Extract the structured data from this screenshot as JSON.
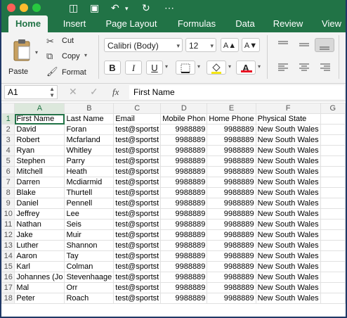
{
  "ribbon": {
    "tabs": [
      "Home",
      "Insert",
      "Page Layout",
      "Formulas",
      "Data",
      "Review",
      "View"
    ],
    "paste_label": "Paste",
    "cut_label": "Cut",
    "copy_label": "Copy",
    "format_label": "Format",
    "font_name": "Calibri (Body)",
    "font_size": "12",
    "bold": "B",
    "italic": "I",
    "underline": "U",
    "grow_font": "A▲",
    "shrink_font": "A▼",
    "highlight_color": "#f5e614",
    "font_color": "#e81123"
  },
  "formula_bar": {
    "name_box": "A1",
    "fx": "fx",
    "content": "First Name"
  },
  "sheet": {
    "columns": [
      "A",
      "B",
      "C",
      "D",
      "E",
      "F",
      "G"
    ],
    "rows": [
      [
        "First Name",
        "Last Name",
        "Email",
        "Mobile Phon",
        "Home Phone",
        "Physical State",
        ""
      ],
      [
        "David",
        "Foran",
        "test@sportst",
        "9988889",
        "9988889",
        "New South Wales",
        ""
      ],
      [
        "Robert",
        "Mcfarland",
        "test@sportst",
        "9988889",
        "9988889",
        "New South Wales",
        ""
      ],
      [
        "Ryan",
        "Whitley",
        "test@sportst",
        "9988889",
        "9988889",
        "New South Wales",
        ""
      ],
      [
        "Stephen",
        "Parry",
        "test@sportst",
        "9988889",
        "9988889",
        "New South Wales",
        ""
      ],
      [
        "Mitchell",
        "Heath",
        "test@sportst",
        "9988889",
        "9988889",
        "New South Wales",
        ""
      ],
      [
        "Darren",
        "Mcdiarmid",
        "test@sportst",
        "9988889",
        "9988889",
        "New South Wales",
        ""
      ],
      [
        "Blake",
        "Thurtell",
        "test@sportst",
        "9988889",
        "9988889",
        "New South Wales",
        ""
      ],
      [
        "Daniel",
        "Pennell",
        "test@sportst",
        "9988889",
        "9988889",
        "New South Wales",
        ""
      ],
      [
        "Jeffrey",
        "Lee",
        "test@sportst",
        "9988889",
        "9988889",
        "New South Wales",
        ""
      ],
      [
        "Nathan",
        "Seis",
        "test@sportst",
        "9988889",
        "9988889",
        "New South Wales",
        ""
      ],
      [
        "Jake",
        "Muir",
        "test@sportst",
        "9988889",
        "9988889",
        "New South Wales",
        ""
      ],
      [
        "Luther",
        "Shannon",
        "test@sportst",
        "9988889",
        "9988889",
        "New South Wales",
        ""
      ],
      [
        "Aaron",
        "Tay",
        "test@sportst",
        "9988889",
        "9988889",
        "New South Wales",
        ""
      ],
      [
        "Karl",
        "Colman",
        "test@sportst",
        "9988889",
        "9988889",
        "New South Wales",
        ""
      ],
      [
        "Johannes (Jo",
        "Stevenhaage",
        "test@sportst",
        "9988889",
        "9988889",
        "New South Wales",
        ""
      ],
      [
        "Mal",
        "Orr",
        "test@sportst",
        "9988889",
        "9988889",
        "New South Wales",
        ""
      ],
      [
        "Peter",
        "Roach",
        "test@sportst",
        "9988889",
        "9988889",
        "New South Wales",
        ""
      ]
    ]
  }
}
